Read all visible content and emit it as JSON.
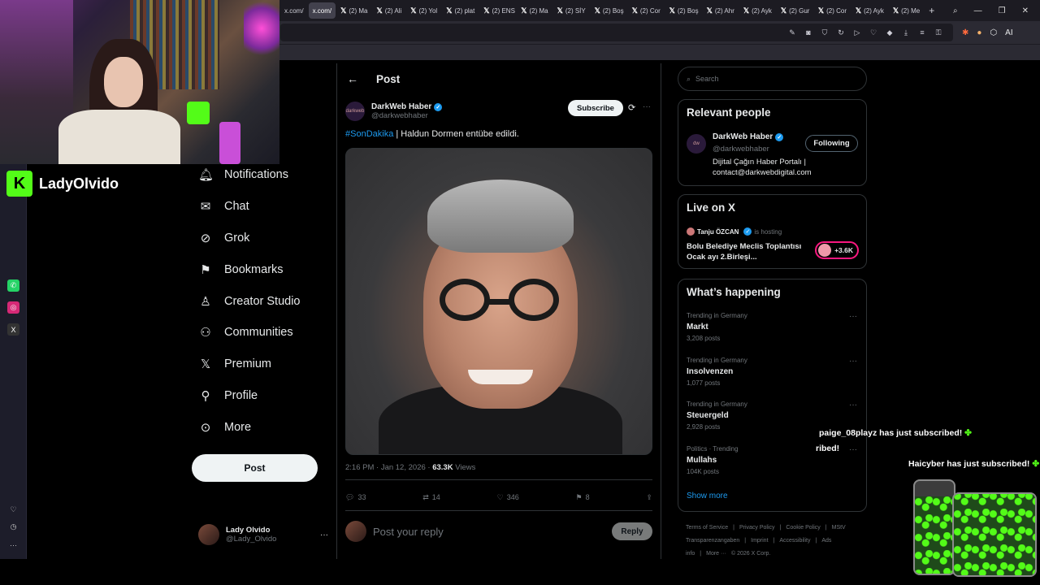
{
  "browser": {
    "tabs": [
      "x.com/",
      "x.com/",
      "(2) Ma",
      "(2) Ali",
      "(2) Yol",
      "(2) plat",
      "(2) ENS",
      "(2) Ma",
      "(2) SİY",
      "(2) Boş",
      "(2) Cor",
      "(2) Boş",
      "(2) Ahr",
      "(2) Ayk",
      "(2) Gur",
      "(2) Cor",
      "(2) Ayk",
      "(2) Me"
    ],
    "new_tab": "+"
  },
  "stream": {
    "name": "LadyOlvido",
    "sub_alert_1": "paige_08playz has just subscribed!",
    "sub_alert_1_partial": "ribed!",
    "sub_alert_2": "Haicyber has just subscribed!"
  },
  "nav": {
    "items": [
      {
        "label": "Notifications",
        "icon": "bell-icon"
      },
      {
        "label": "Chat",
        "icon": "mail-icon"
      },
      {
        "label": "Grok",
        "icon": "grok-icon"
      },
      {
        "label": "Bookmarks",
        "icon": "bookmark-icon"
      },
      {
        "label": "Creator Studio",
        "icon": "creator-icon"
      },
      {
        "label": "Communities",
        "icon": "people-icon"
      },
      {
        "label": "Premium",
        "icon": "x-icon"
      },
      {
        "label": "Profile",
        "icon": "person-icon"
      },
      {
        "label": "More",
        "icon": "more-icon"
      }
    ],
    "post_button": "Post",
    "account": {
      "name": "Lady Olvido",
      "handle": "@Lady_Olvido"
    }
  },
  "post": {
    "header": "Post",
    "author_name": "DarkWeb Haber",
    "author_handle": "@darkwebhaber",
    "avatar_text": "darkweb",
    "subscribe": "Subscribe",
    "hashtag": "#SonDakika",
    "text": " | Haldun Dormen entübe edildi.",
    "time": "2:16 PM · Jan 12, 2026 · ",
    "views_count": "63.3K",
    "views_label": " Views",
    "replies": "33",
    "reposts": "14",
    "likes": "346",
    "bookmarks": "8",
    "reply_placeholder": "Post your reply",
    "reply_button": "Reply"
  },
  "sidebar": {
    "search_placeholder": "Search",
    "relevant_title": "Relevant people",
    "relevant_name": "DarkWeb Haber",
    "relevant_handle": "@darkwebhaber",
    "relevant_bio": "Dijital Çağın Haber Portalı | contact@darkwebdigital.com",
    "following": "Following",
    "live_title": "Live on X",
    "live_host": "Tanju ÖZCAN",
    "live_hosting": "is hosting",
    "live_topic": "Bolu Belediye Meclis Toplantısı Ocak ayı 2.Birleşi...",
    "live_count": "+3.6K",
    "happening_title": "What’s happening",
    "trends": [
      {
        "context": "Trending in Germany",
        "name": "Markt",
        "posts": "3,208 posts"
      },
      {
        "context": "Trending in Germany",
        "name": "Insolvenzen",
        "posts": "1,077 posts"
      },
      {
        "context": "Trending in Germany",
        "name": "Steuergeld",
        "posts": "2,928 posts"
      },
      {
        "context": "Politics · Trending",
        "name": "Mullahs",
        "posts": "104K posts"
      }
    ],
    "show_more": "Show more",
    "footer": [
      "Terms of Service",
      "|",
      "Privacy Policy",
      "|",
      "Cookie Policy",
      "|",
      "MStV Transparenzangaben",
      "|",
      "Imprint",
      "|",
      "Accessibility",
      "|",
      "Ads info",
      "|",
      "More ···",
      "© 2026 X Corp."
    ]
  },
  "colors": {
    "accent": "#1d9bf0",
    "kick": "#53fc18",
    "bg": "#000000"
  }
}
